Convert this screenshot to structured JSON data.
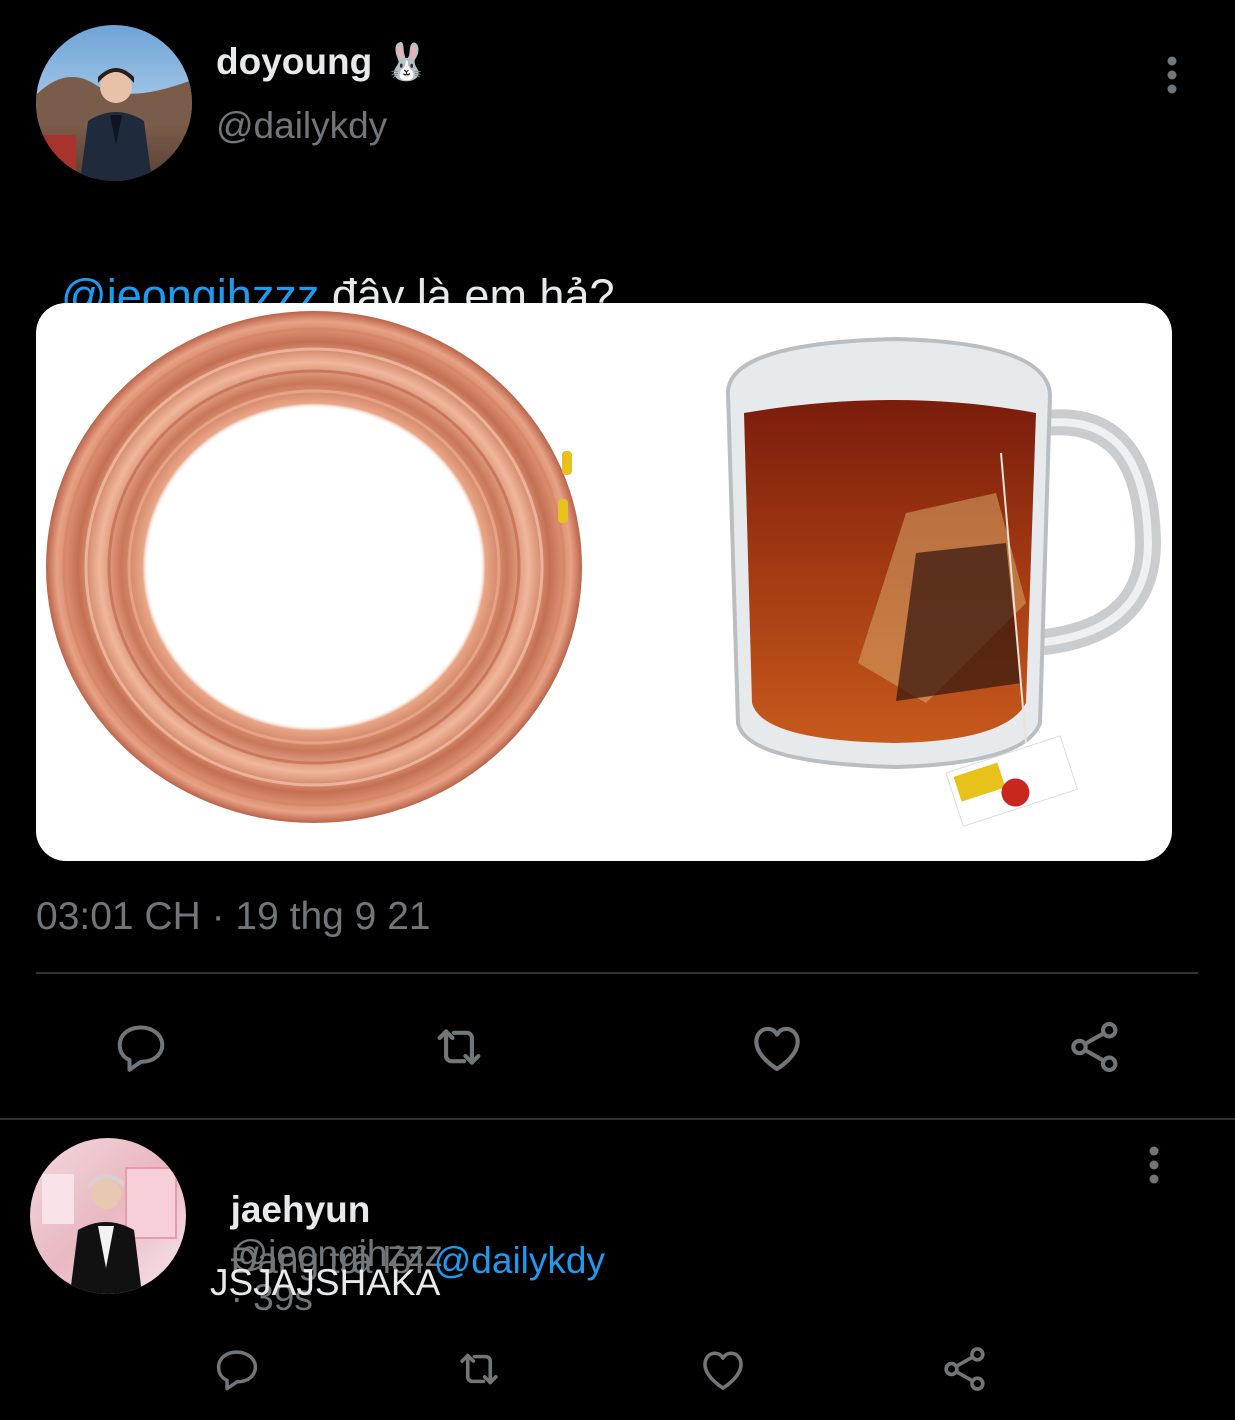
{
  "tweet": {
    "display_name": "doyoung",
    "emoji": "🐰",
    "handle": "@dailykdy",
    "mention": "@jeongjhzzz",
    "text": " đây là em hả?",
    "timestamp": "03:01 CH · 19 thg 9 21"
  },
  "actions": [
    "reply-icon",
    "retweet-icon",
    "like-icon",
    "share-icon"
  ],
  "reply": {
    "display_name": "jaehyun",
    "handle": "@jeongjhzzz",
    "time": "· 39s",
    "replying_prefix": "Đang trả lời ",
    "replying_to": "@dailykdy",
    "text": "JSJAJSHAKA"
  },
  "colors": {
    "background": "#000000",
    "accent": "#1d9bf0",
    "muted": "#71767b",
    "divider": "#2f3336"
  }
}
